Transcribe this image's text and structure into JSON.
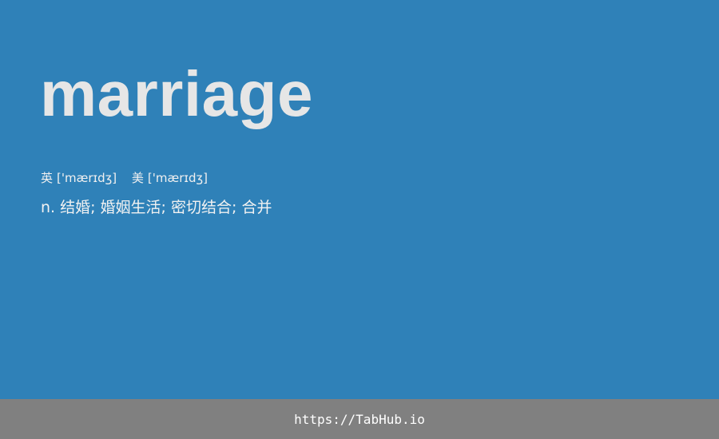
{
  "entry": {
    "word": "marriage",
    "phonetics": {
      "uk_label": "英",
      "uk_ipa": "['mærɪdʒ]",
      "us_label": "美",
      "us_ipa": "['mærɪdʒ]"
    },
    "definition": "n. 结婚; 婚姻生活; 密切结合; 合并"
  },
  "footer": {
    "link_text": "https://TabHub.io"
  },
  "colors": {
    "background": "#2f81b8",
    "word": "#e6e6e6",
    "footer_bg": "#808080",
    "footer_text": "#ffffff"
  }
}
